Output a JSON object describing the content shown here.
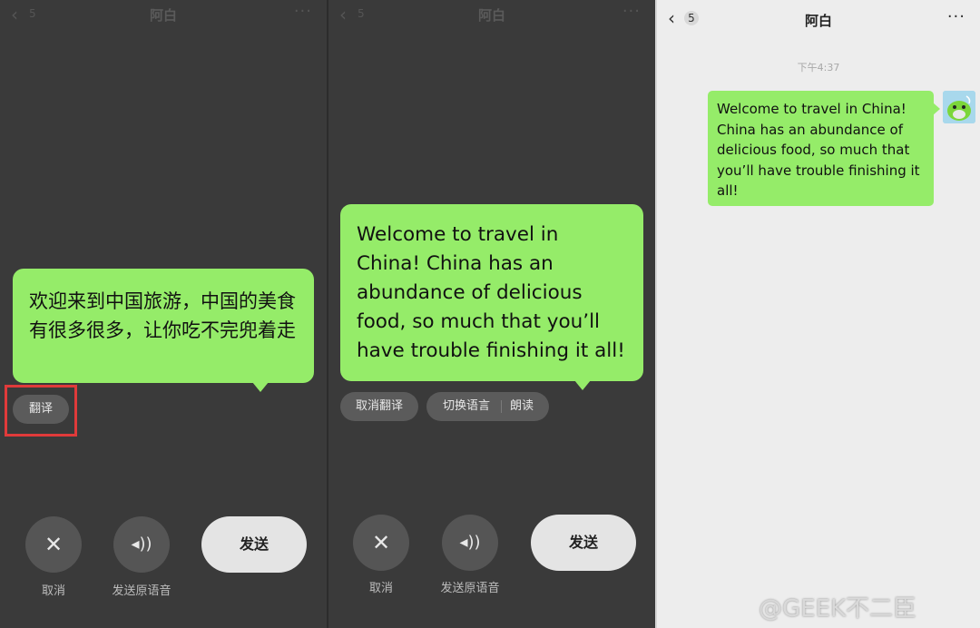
{
  "panel1": {
    "header": {
      "back_icon": "chevron-left-icon",
      "unread_count": "5",
      "title": "阿白",
      "more_label": "···"
    },
    "bubble_text": "欢迎来到中国旅游，中国的美食有很多很多，让你吃不完兜着走",
    "translate_label": "翻译",
    "cancel_label": "取消",
    "send_voice_label": "发送原语音",
    "send_label": "发送"
  },
  "panel2": {
    "header": {
      "back_icon": "chevron-left-icon",
      "unread_count": "5",
      "title": "阿白",
      "more_label": "···"
    },
    "bubble_text": "Welcome to travel in China! China has an abundance of delicious food, so much that you’ll have trouble finishing it all!",
    "cancel_translate_label": "取消翻译",
    "switch_language_label": "切换语言",
    "read_aloud_label": "朗读",
    "cancel_label": "取消",
    "send_voice_label": "发送原语音",
    "send_label": "发送"
  },
  "panel3": {
    "header": {
      "back_icon": "chevron-left-icon",
      "unread_count": "5",
      "title": "阿白",
      "more_label": "···"
    },
    "timestamp": "下午4:37",
    "message_text": "Welcome to travel in China! China has an abundance of delicious food, so much that you’ll have trouble finishing it all!"
  },
  "watermark": "@GEEK不二臣",
  "colors": {
    "bubble_green": "#95ec69",
    "dark_bg": "#3a3a3a",
    "light_bg": "#ededed",
    "highlight_red": "#e03a3a"
  }
}
